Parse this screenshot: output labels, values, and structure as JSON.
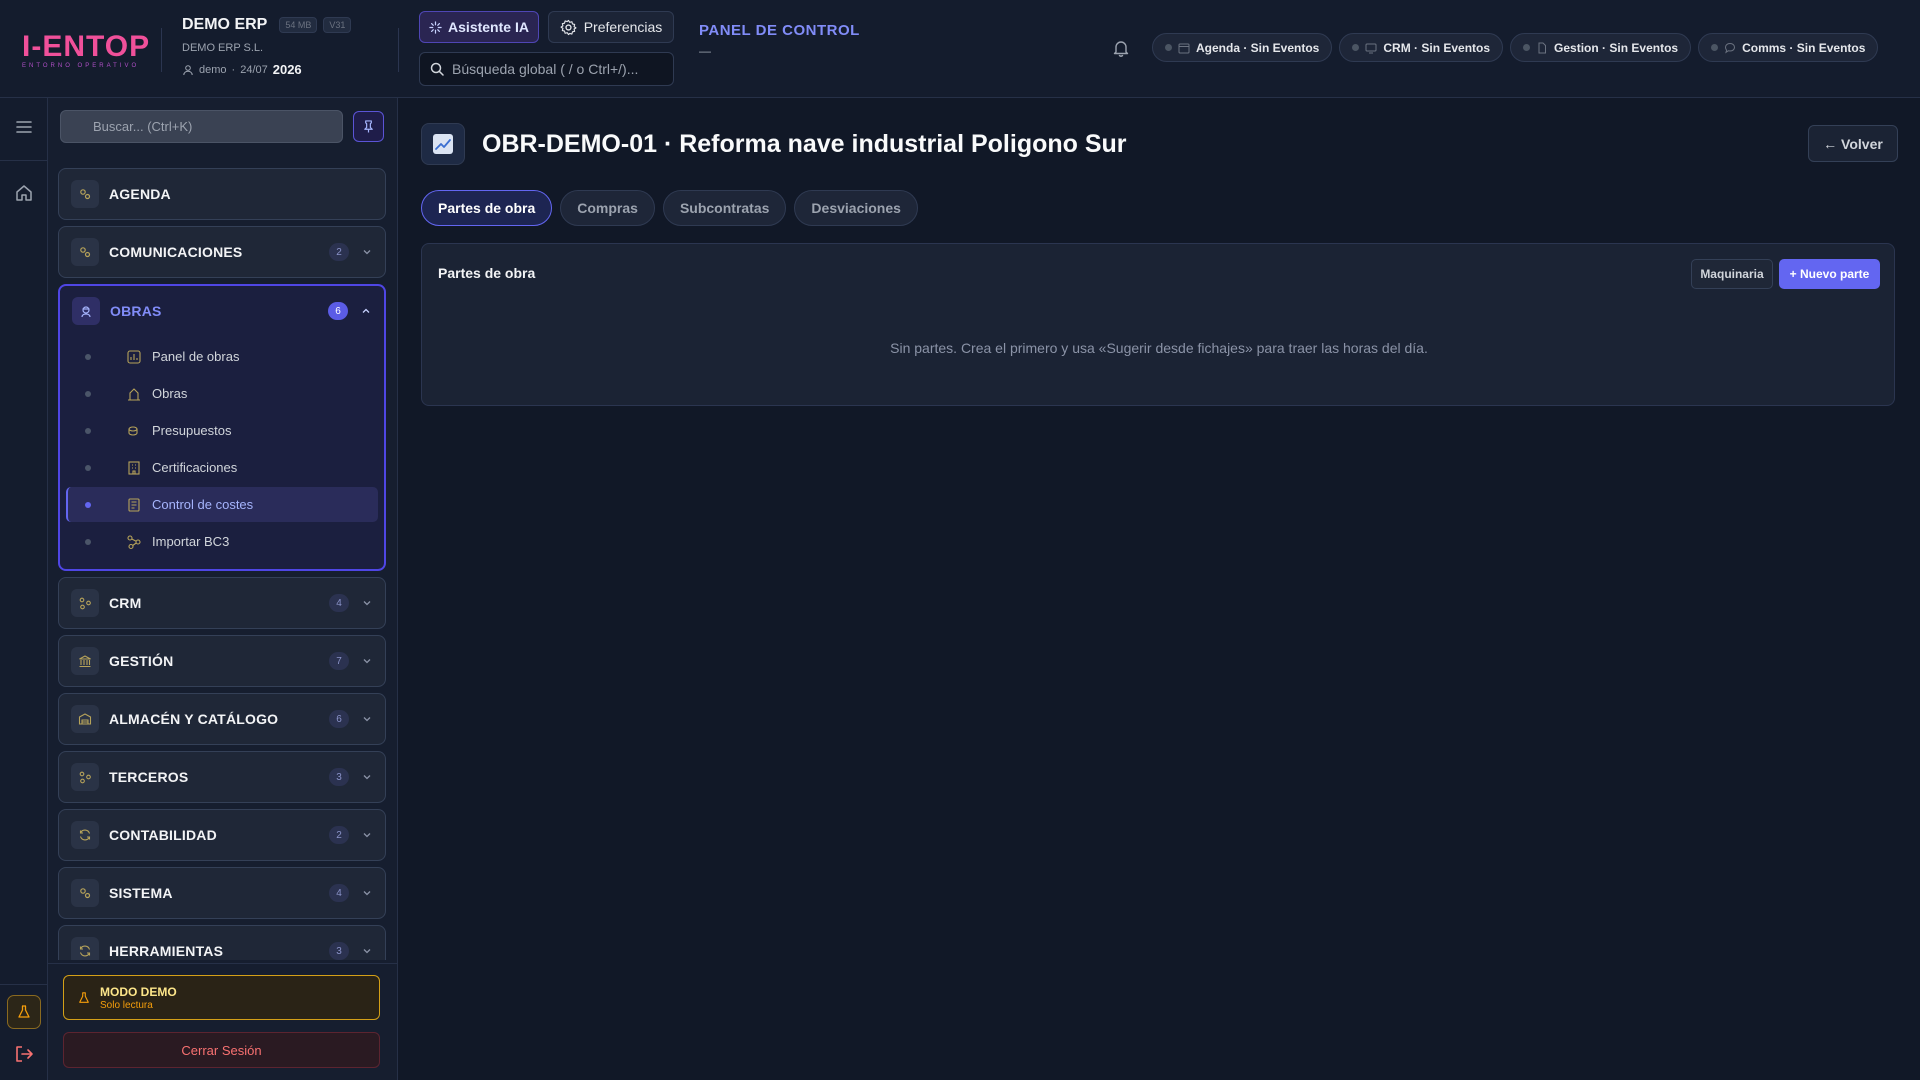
{
  "brand": {
    "logo_text": "I-ENTOP",
    "logo_sub": "ENTORNO OPERATIVO"
  },
  "company": {
    "name": "DEMO ERP",
    "size_chip": "54 MB",
    "version_chip": "V31",
    "legal_name": "DEMO ERP S.L.",
    "user": "demo",
    "date": "24/07",
    "year": "2026"
  },
  "header": {
    "ai_button": "Asistente IA",
    "prefs_button": "Preferencias",
    "search_placeholder": "Búsqueda global ( / o Ctrl+/)...",
    "panel_title": "PANEL DE CONTROL",
    "panel_sub": "—",
    "status": [
      {
        "label": "Agenda · Sin Eventos",
        "icon": "calendar-icon"
      },
      {
        "label": "CRM · Sin Eventos",
        "icon": "monitor-icon"
      },
      {
        "label": "Gestion · Sin Eventos",
        "icon": "document-icon"
      },
      {
        "label": "Comms · Sin Eventos",
        "icon": "chat-icon"
      }
    ]
  },
  "sidebar": {
    "search_placeholder": "Buscar... (Ctrl+K)",
    "groups": [
      {
        "label": "AGENDA",
        "badge": ""
      },
      {
        "label": "COMUNICACIONES",
        "badge": "2"
      },
      {
        "label": "OBRAS",
        "badge": "6",
        "open": true,
        "items": [
          {
            "label": "Panel de obras"
          },
          {
            "label": "Obras"
          },
          {
            "label": "Presupuestos"
          },
          {
            "label": "Certificaciones"
          },
          {
            "label": "Control de costes",
            "active": true
          },
          {
            "label": "Importar BC3"
          }
        ]
      },
      {
        "label": "CRM",
        "badge": "4"
      },
      {
        "label": "GESTIÓN",
        "badge": "7"
      },
      {
        "label": "ALMACÉN Y CATÁLOGO",
        "badge": "6"
      },
      {
        "label": "TERCEROS",
        "badge": "3"
      },
      {
        "label": "CONTABILIDAD",
        "badge": "2"
      },
      {
        "label": "SISTEMA",
        "badge": "4"
      },
      {
        "label": "HERRAMIENTAS",
        "badge": "3"
      }
    ],
    "demo_title": "MODO DEMO",
    "demo_sub": "Solo lectura",
    "logout": "Cerrar Sesión"
  },
  "main": {
    "title": "OBR-DEMO-01 · Reforma nave industrial Poligono Sur",
    "back": "← Volver",
    "tabs": [
      "Partes de obra",
      "Compras",
      "Subcontratas",
      "Desviaciones"
    ],
    "card_title": "Partes de obra",
    "maquinaria_btn": "Maquinaria",
    "nuevo_btn": "+ Nuevo parte",
    "empty": "Sin partes. Crea el primero y usa «Sugerir desde fichajes» para traer las horas del día."
  },
  "colors": {
    "accent": "#6366f1",
    "background": "#111827",
    "panel": "#1b2334",
    "warning": "#d4a017",
    "danger": "#f87171",
    "brand": "#f0509a"
  }
}
